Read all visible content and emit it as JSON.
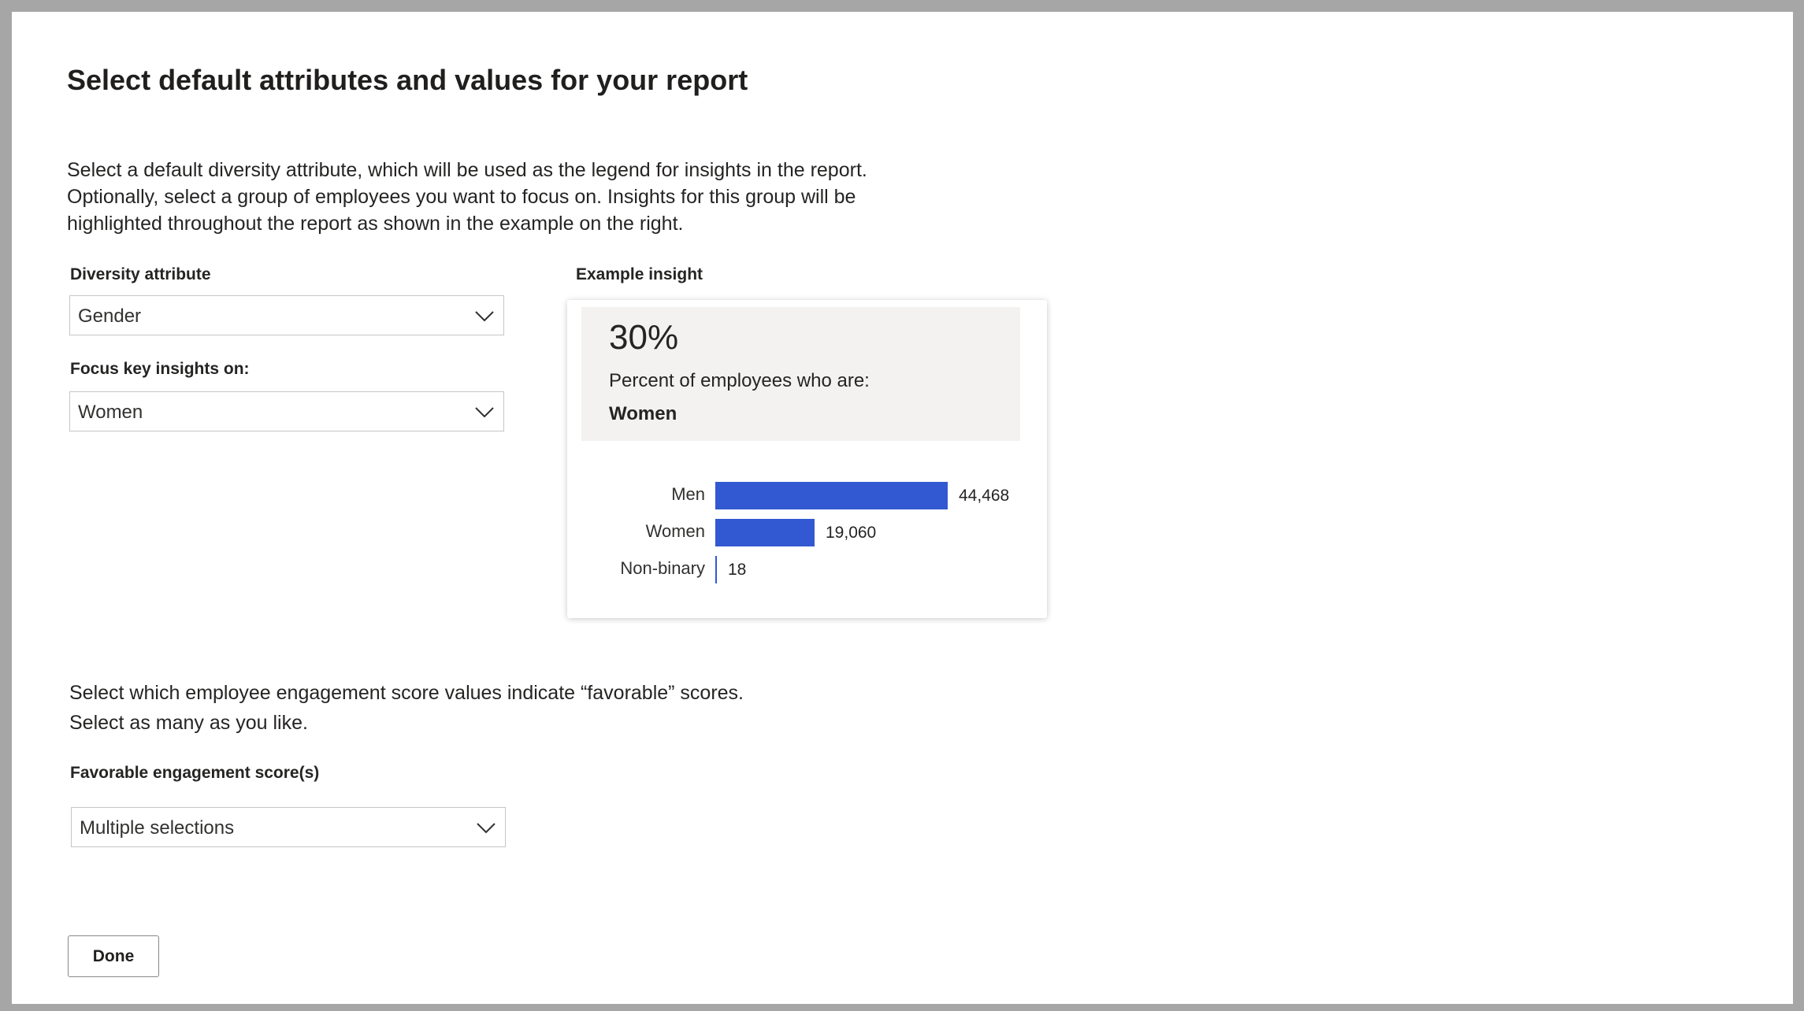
{
  "page": {
    "title": "Select default attributes and values for your report",
    "intro_lines": [
      "Select a default diversity attribute, which will be used as the legend for insights in the report.",
      "Optionally, select a group of employees you want to focus on. Insights for this group will be",
      "highlighted throughout the report as shown in the example on the right."
    ]
  },
  "diversity": {
    "label": "Diversity attribute",
    "value": "Gender"
  },
  "focus": {
    "label": "Focus key insights on:",
    "value": "Women"
  },
  "example": {
    "label": "Example insight",
    "percent": "30%",
    "description": "Percent of employees who are:",
    "group": "Women"
  },
  "chart_data": {
    "type": "bar",
    "orientation": "horizontal",
    "categories": [
      "Men",
      "Women",
      "Non-binary"
    ],
    "values": [
      44468,
      19060,
      18
    ],
    "value_labels": [
      "44,468",
      "19,060",
      "18"
    ],
    "bar_color": "#3259d1",
    "grid": false
  },
  "engagement": {
    "line1": "Select which employee engagement score values indicate “favorable” scores.",
    "line2": "Select as many as you like.",
    "label": "Favorable engagement score(s)",
    "value": "Multiple selections"
  },
  "actions": {
    "done_label": "Done"
  },
  "icons": {
    "dropdown": "chevron-down-icon"
  }
}
